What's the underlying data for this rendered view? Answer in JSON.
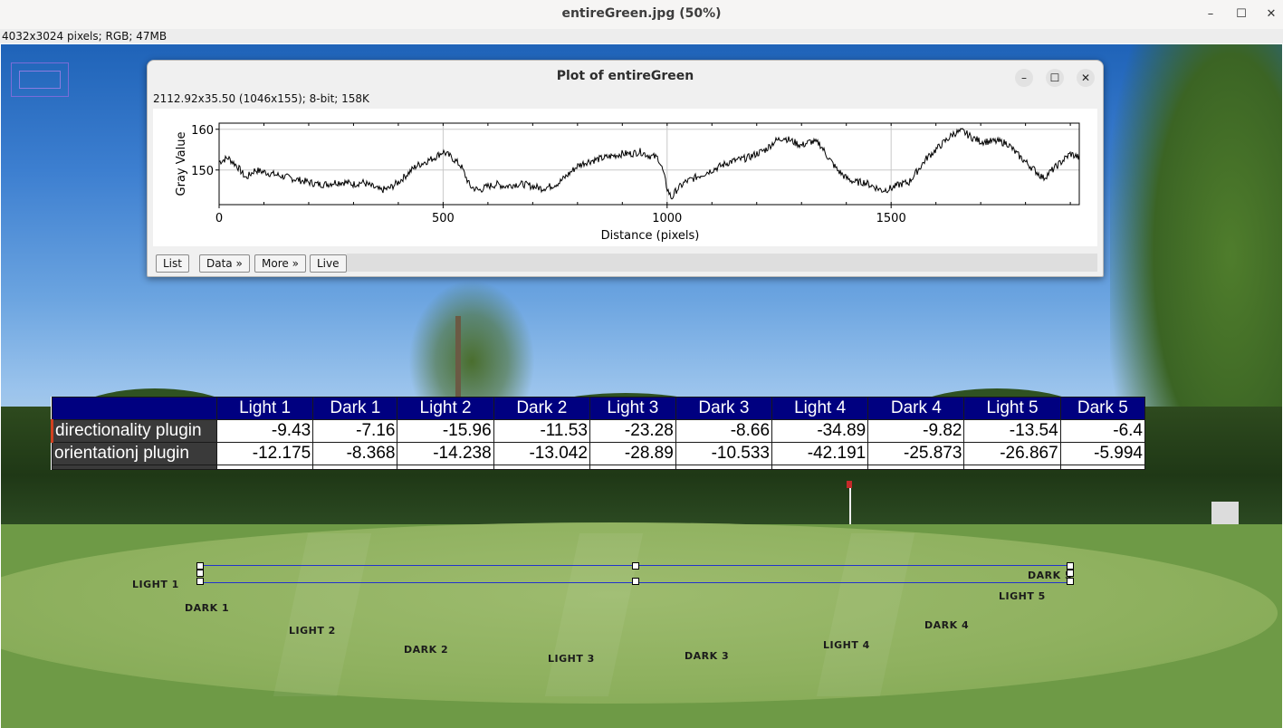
{
  "window": {
    "title": "entireGreen.jpg (50%)",
    "info": "4032x3024 pixels; RGB; 47MB",
    "controls": {
      "minimize": "–",
      "maximize": "☐",
      "close": "✕"
    }
  },
  "plot_window": {
    "title": "Plot of entireGreen",
    "info": "2112.92x35.50   (1046x155); 8-bit; 158K",
    "controls": {
      "minimize": "–",
      "maximize": "☐",
      "close": "✕"
    },
    "buttons": {
      "list": "List",
      "data": "Data »",
      "more": "More »",
      "live": "Live"
    }
  },
  "table": {
    "columns": [
      "Light 1",
      "Dark 1",
      "Light 2",
      "Dark 2",
      "Light 3",
      "Dark 3",
      "Light 4",
      "Dark 4",
      "Light 5",
      "Dark 5"
    ],
    "rows": [
      {
        "label": "directionality plugin",
        "values": [
          "-9.43",
          "-7.16",
          "-15.96",
          "-11.53",
          "-23.28",
          "-8.66",
          "-34.89",
          "-9.82",
          "-13.54",
          "-6.4"
        ]
      },
      {
        "label": "orientationj plugin",
        "values": [
          "-12.175",
          "-8.368",
          "-14.238",
          "-13.042",
          "-28.89",
          "-10.533",
          "-42.191",
          "-25.873",
          "-26.867",
          "-5.994"
        ]
      }
    ]
  },
  "labels": {
    "light1": "LIGHT 1",
    "dark1": "DARK 1",
    "light2": "LIGHT 2",
    "dark2": "DARK 2",
    "light3": "LIGHT 3",
    "dark3": "DARK 3",
    "light4": "LIGHT 4",
    "dark4": "DARK 4",
    "light5": "LIGHT 5",
    "dark5": "DARK 5"
  },
  "chart_data": {
    "type": "line",
    "xlabel": "Distance (pixels)",
    "ylabel": "Gray Value",
    "xlim": [
      0,
      1920
    ],
    "ylim": [
      141.5,
      161.5
    ],
    "xticks": [
      0,
      500,
      1000,
      1500
    ],
    "yticks": [
      150,
      160
    ],
    "grid": true,
    "series": [
      {
        "x": [
          0,
          20,
          40,
          60,
          80,
          100,
          120,
          140,
          160,
          180,
          200,
          220,
          240,
          260,
          280,
          300,
          320,
          340,
          360,
          380,
          400,
          420,
          440,
          460,
          480,
          500,
          520,
          540,
          560,
          580,
          600,
          620,
          640,
          660,
          680,
          700,
          720,
          740,
          760,
          780,
          800,
          820,
          840,
          860,
          880,
          900,
          920,
          940,
          960,
          980,
          990,
          1000,
          1010,
          1020,
          1040,
          1060,
          1080,
          1100,
          1120,
          1140,
          1160,
          1180,
          1200,
          1220,
          1240,
          1260,
          1280,
          1300,
          1320,
          1340,
          1360,
          1380,
          1400,
          1420,
          1440,
          1460,
          1480,
          1500,
          1520,
          1540,
          1560,
          1580,
          1600,
          1620,
          1640,
          1660,
          1680,
          1700,
          1720,
          1740,
          1760,
          1780,
          1800,
          1820,
          1840,
          1860,
          1880,
          1900,
          1920
        ],
        "y": [
          152,
          153,
          151,
          148,
          150,
          149.5,
          149,
          148.5,
          148,
          147.5,
          147,
          146.5,
          146.5,
          147,
          147,
          146.5,
          147,
          146,
          145,
          145.5,
          147,
          149,
          151,
          152,
          153,
          154.5,
          153,
          151,
          146,
          145,
          146,
          146.5,
          146,
          146.5,
          146.5,
          146,
          145.5,
          146,
          147,
          149,
          151,
          152,
          152.5,
          153,
          153.5,
          154,
          154,
          154.5,
          153.5,
          153,
          150,
          145.5,
          143,
          145,
          147,
          148,
          149,
          150,
          151,
          152,
          152.5,
          153,
          154,
          155,
          157,
          158,
          157,
          156,
          157,
          156.5,
          153,
          150,
          148,
          147,
          147,
          146,
          145,
          145.5,
          146.5,
          147,
          150,
          153,
          155,
          157,
          159,
          159.5,
          158,
          157,
          157,
          157,
          156.5,
          154,
          152,
          150,
          148,
          150,
          152,
          154,
          153
        ]
      }
    ]
  }
}
